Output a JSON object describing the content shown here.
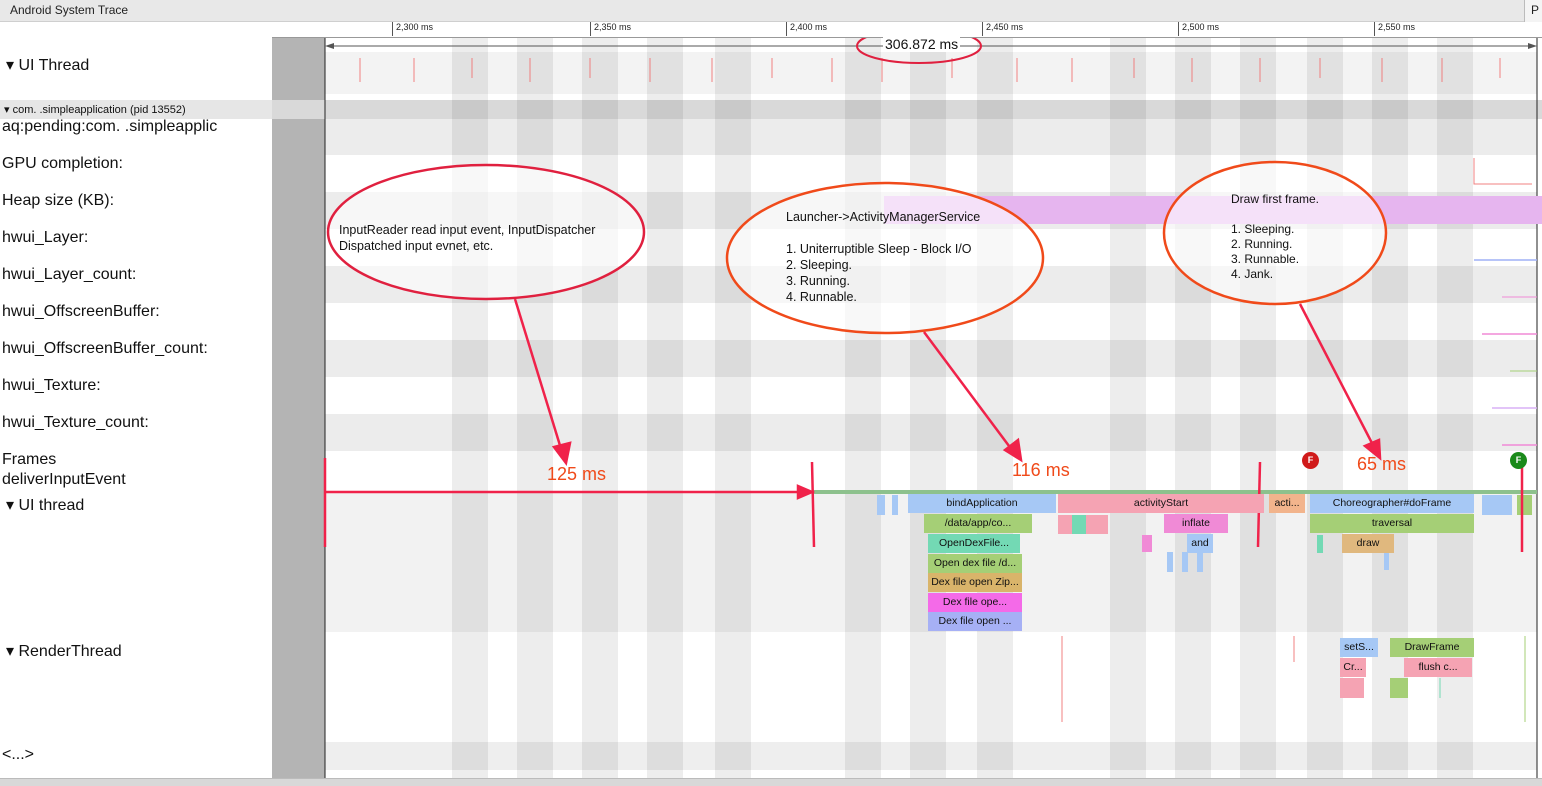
{
  "window": {
    "title": "Android System Trace",
    "corner_label": "P"
  },
  "tracks": {
    "ui_thread_top": "▾  UI Thread",
    "process": "▾ com.        .simpleapplication (pid 13552)",
    "aq_pending": "aq:pending:com.        .simpleapplic",
    "gpu_completion": "GPU completion:",
    "heap_size": "Heap size (KB):",
    "hwui_layer": "hwui_Layer:",
    "hwui_layer_count": "hwui_Layer_count:",
    "hwui_offscreen": "hwui_OffscreenBuffer:",
    "hwui_offscreen_count": "hwui_OffscreenBuffer_count:",
    "hwui_texture": "hwui_Texture:",
    "hwui_texture_count": "hwui_Texture_count:",
    "frames": "Frames",
    "deliver_input": "deliverInputEvent",
    "ui_thread": "▾  UI thread",
    "render_thread": "▾  RenderThread",
    "more": "<...>"
  },
  "ruler": {
    "ticks": [
      "2,300 ms",
      "2,350 ms",
      "2,400 ms",
      "2,450 ms",
      "2,500 ms",
      "2,550 ms"
    ],
    "selection": "306.872 ms"
  },
  "callouts": {
    "input": "InputReader read input event, InputDispatcher\nDispatched input evnet, etc.",
    "launcher": "Launcher->ActivityManagerService\n\n1. Uniterruptible Sleep - Block I/O\n2. Sleeping.\n3. Running.\n4. Runnable.",
    "draw": "Draw first frame.\n\n1. Sleeping.\n2. Running.\n3. Runnable.\n4. Jank."
  },
  "durations": {
    "first": "125 ms",
    "second": "116 ms",
    "third": "65 ms"
  },
  "frame_markers": {
    "red": "F",
    "green": "F"
  },
  "ui_slices": [
    {
      "label": "bindApplication",
      "color": "#a6c8f5"
    },
    {
      "label": "activityStart",
      "color": "#f5a3b3"
    },
    {
      "label": "acti...",
      "color": "#f2b48c"
    },
    {
      "label": "Choreographer#doFrame",
      "color": "#a6c8f5"
    },
    {
      "label": "/data/app/co...",
      "color": "#a5cf76"
    },
    {
      "label": "inflate",
      "color": "#f08ad6"
    },
    {
      "label": "traversal",
      "color": "#a5cf76"
    },
    {
      "label": "OpenDexFile...",
      "color": "#73d9b4"
    },
    {
      "label": "and",
      "color": "#a6c8f5"
    },
    {
      "label": "draw",
      "color": "#e0b87e"
    },
    {
      "label": "Open dex file /d...",
      "color": "#a5cf76"
    },
    {
      "label": "Dex file open Zip...",
      "color": "#d9b46a"
    },
    {
      "label": "Dex file ope...",
      "color": "#f46ae8"
    },
    {
      "label": "Dex file open ...",
      "color": "#a6b0f5"
    }
  ],
  "render_slices": [
    {
      "label": "setS...",
      "color": "#a6c8f5"
    },
    {
      "label": "DrawFrame",
      "color": "#a5cf76"
    },
    {
      "label": "Cr...",
      "color": "#f5a3b3"
    },
    {
      "label": "flush c...",
      "color": "#f5a3b3"
    }
  ],
  "colors": {
    "annotation": "#f0224a",
    "callout": "#f04a1a",
    "heap": "#e6b5ef"
  }
}
